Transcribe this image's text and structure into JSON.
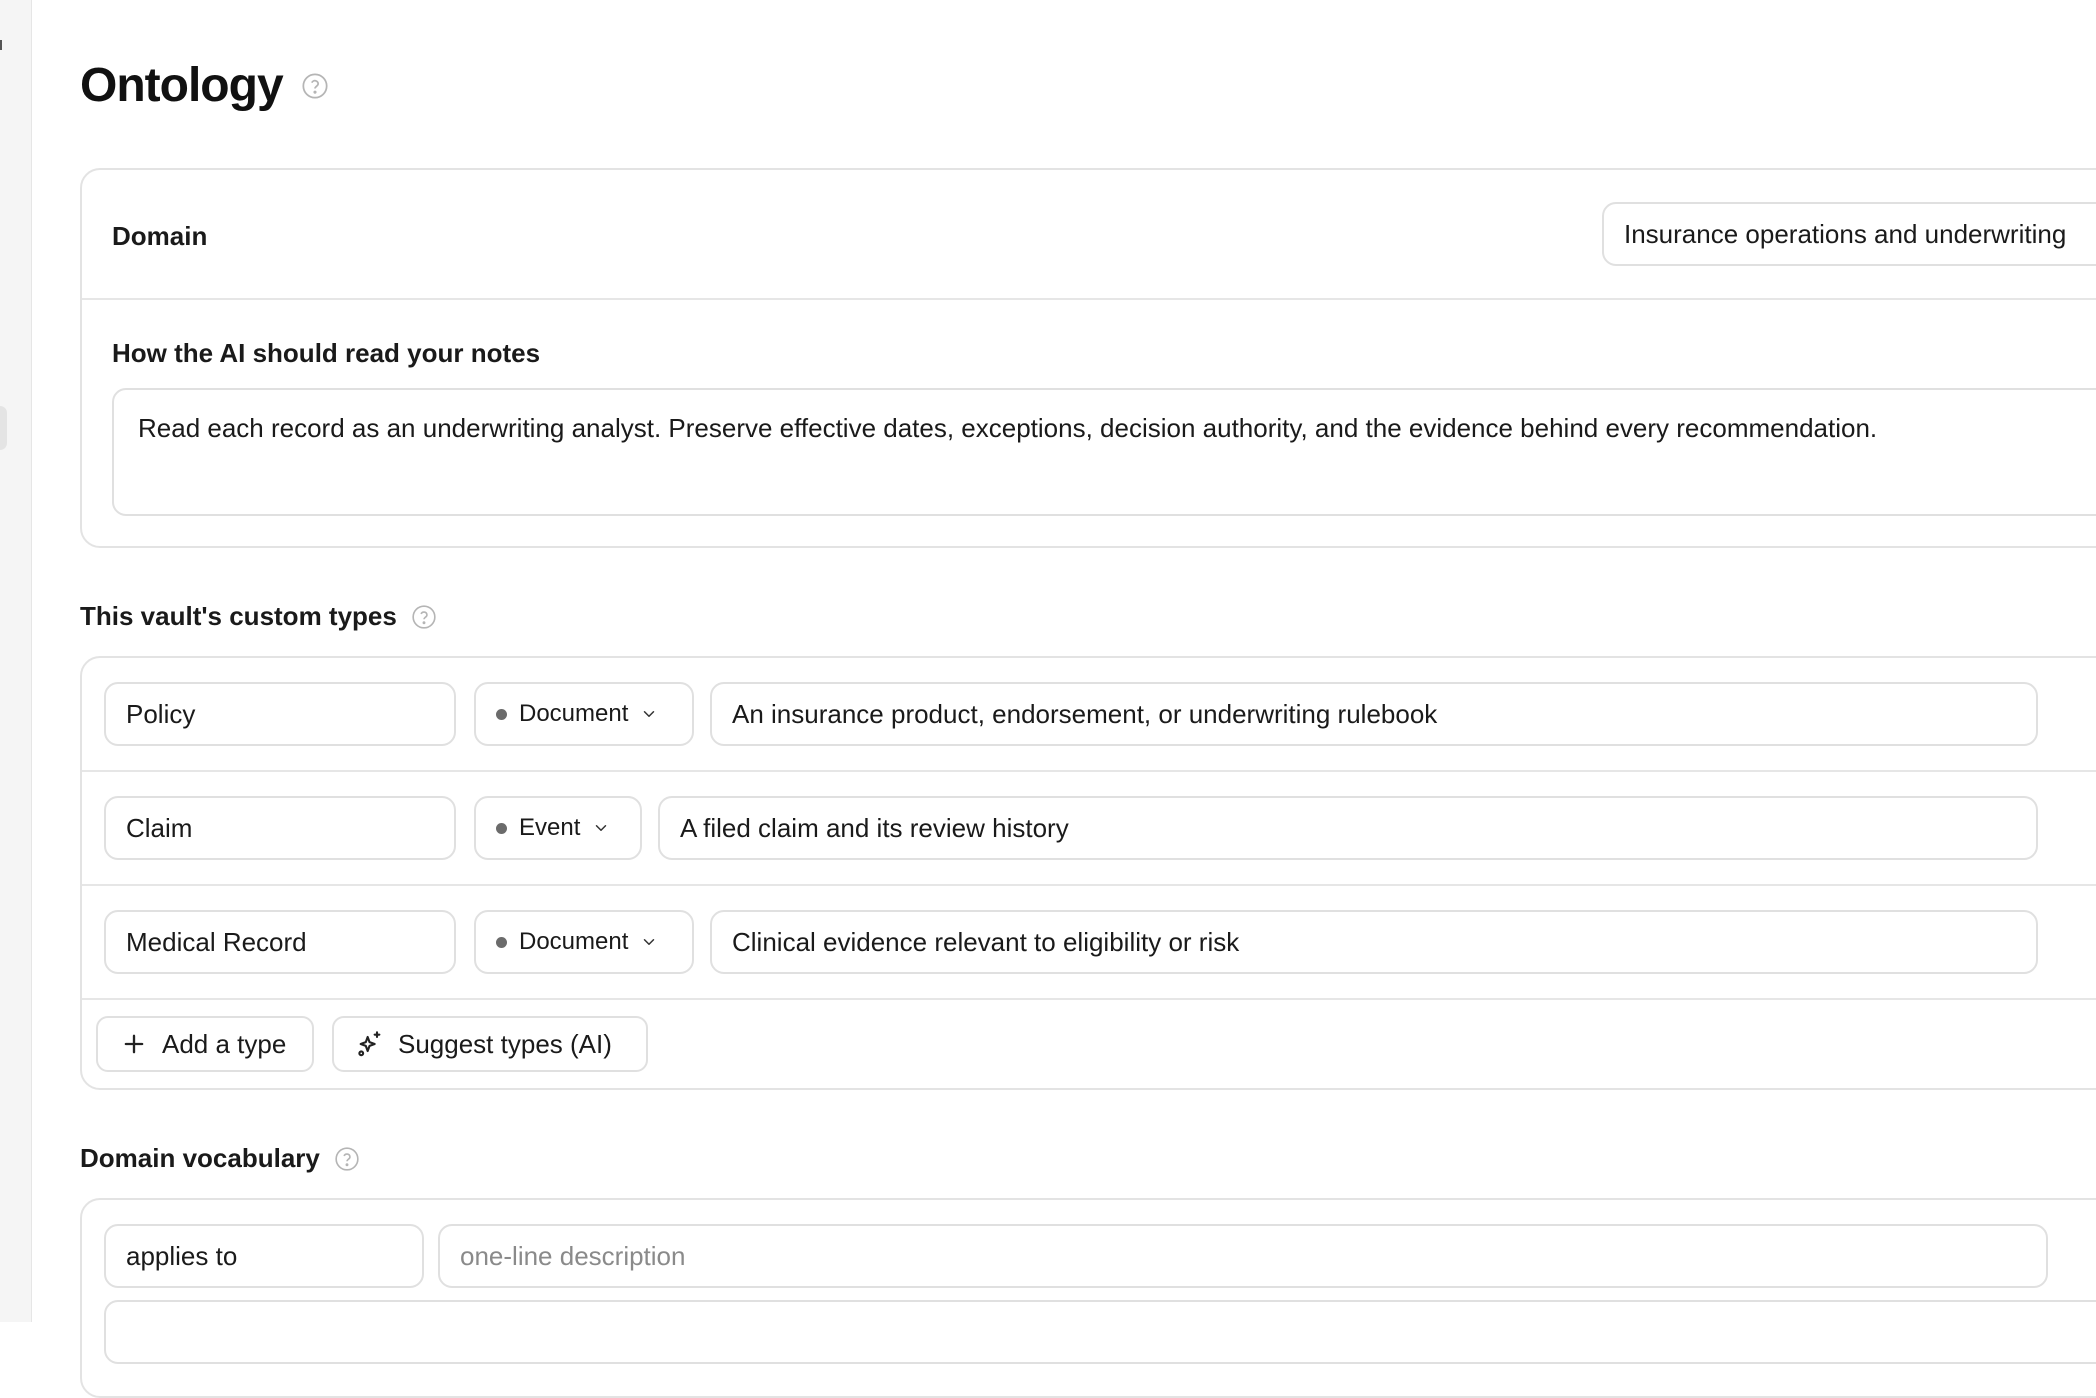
{
  "page": {
    "title": "Ontology"
  },
  "domain": {
    "label": "Domain",
    "value": "Insurance operations and underwriting",
    "notes_label": "How the AI should read your notes",
    "notes_value": "Read each record as an underwriting analyst. Preserve effective dates, exceptions, decision authority, and the evidence behind every recommendation."
  },
  "custom_types": {
    "title": "This vault's custom types",
    "items": [
      {
        "name": "Policy",
        "kind": "Document",
        "description": "An insurance product, endorsement, or underwriting rulebook"
      },
      {
        "name": "Claim",
        "kind": "Event",
        "description": "A filed claim and its review history"
      },
      {
        "name": "Medical Record",
        "kind": "Document",
        "description": "Clinical evidence relevant to eligibility or risk"
      }
    ],
    "add_label": "Add a type",
    "suggest_label": "Suggest types (AI)"
  },
  "vocabulary": {
    "title": "Domain vocabulary",
    "items": [
      {
        "term": "applies to",
        "description": "",
        "description_placeholder": "one-line description"
      }
    ]
  },
  "icons": {
    "help": "help-circle-icon",
    "chevron": "chevron-down-icon",
    "trash": "trash-icon",
    "plus": "plus-icon",
    "sparkles": "sparkles-icon",
    "close": "close-icon"
  }
}
